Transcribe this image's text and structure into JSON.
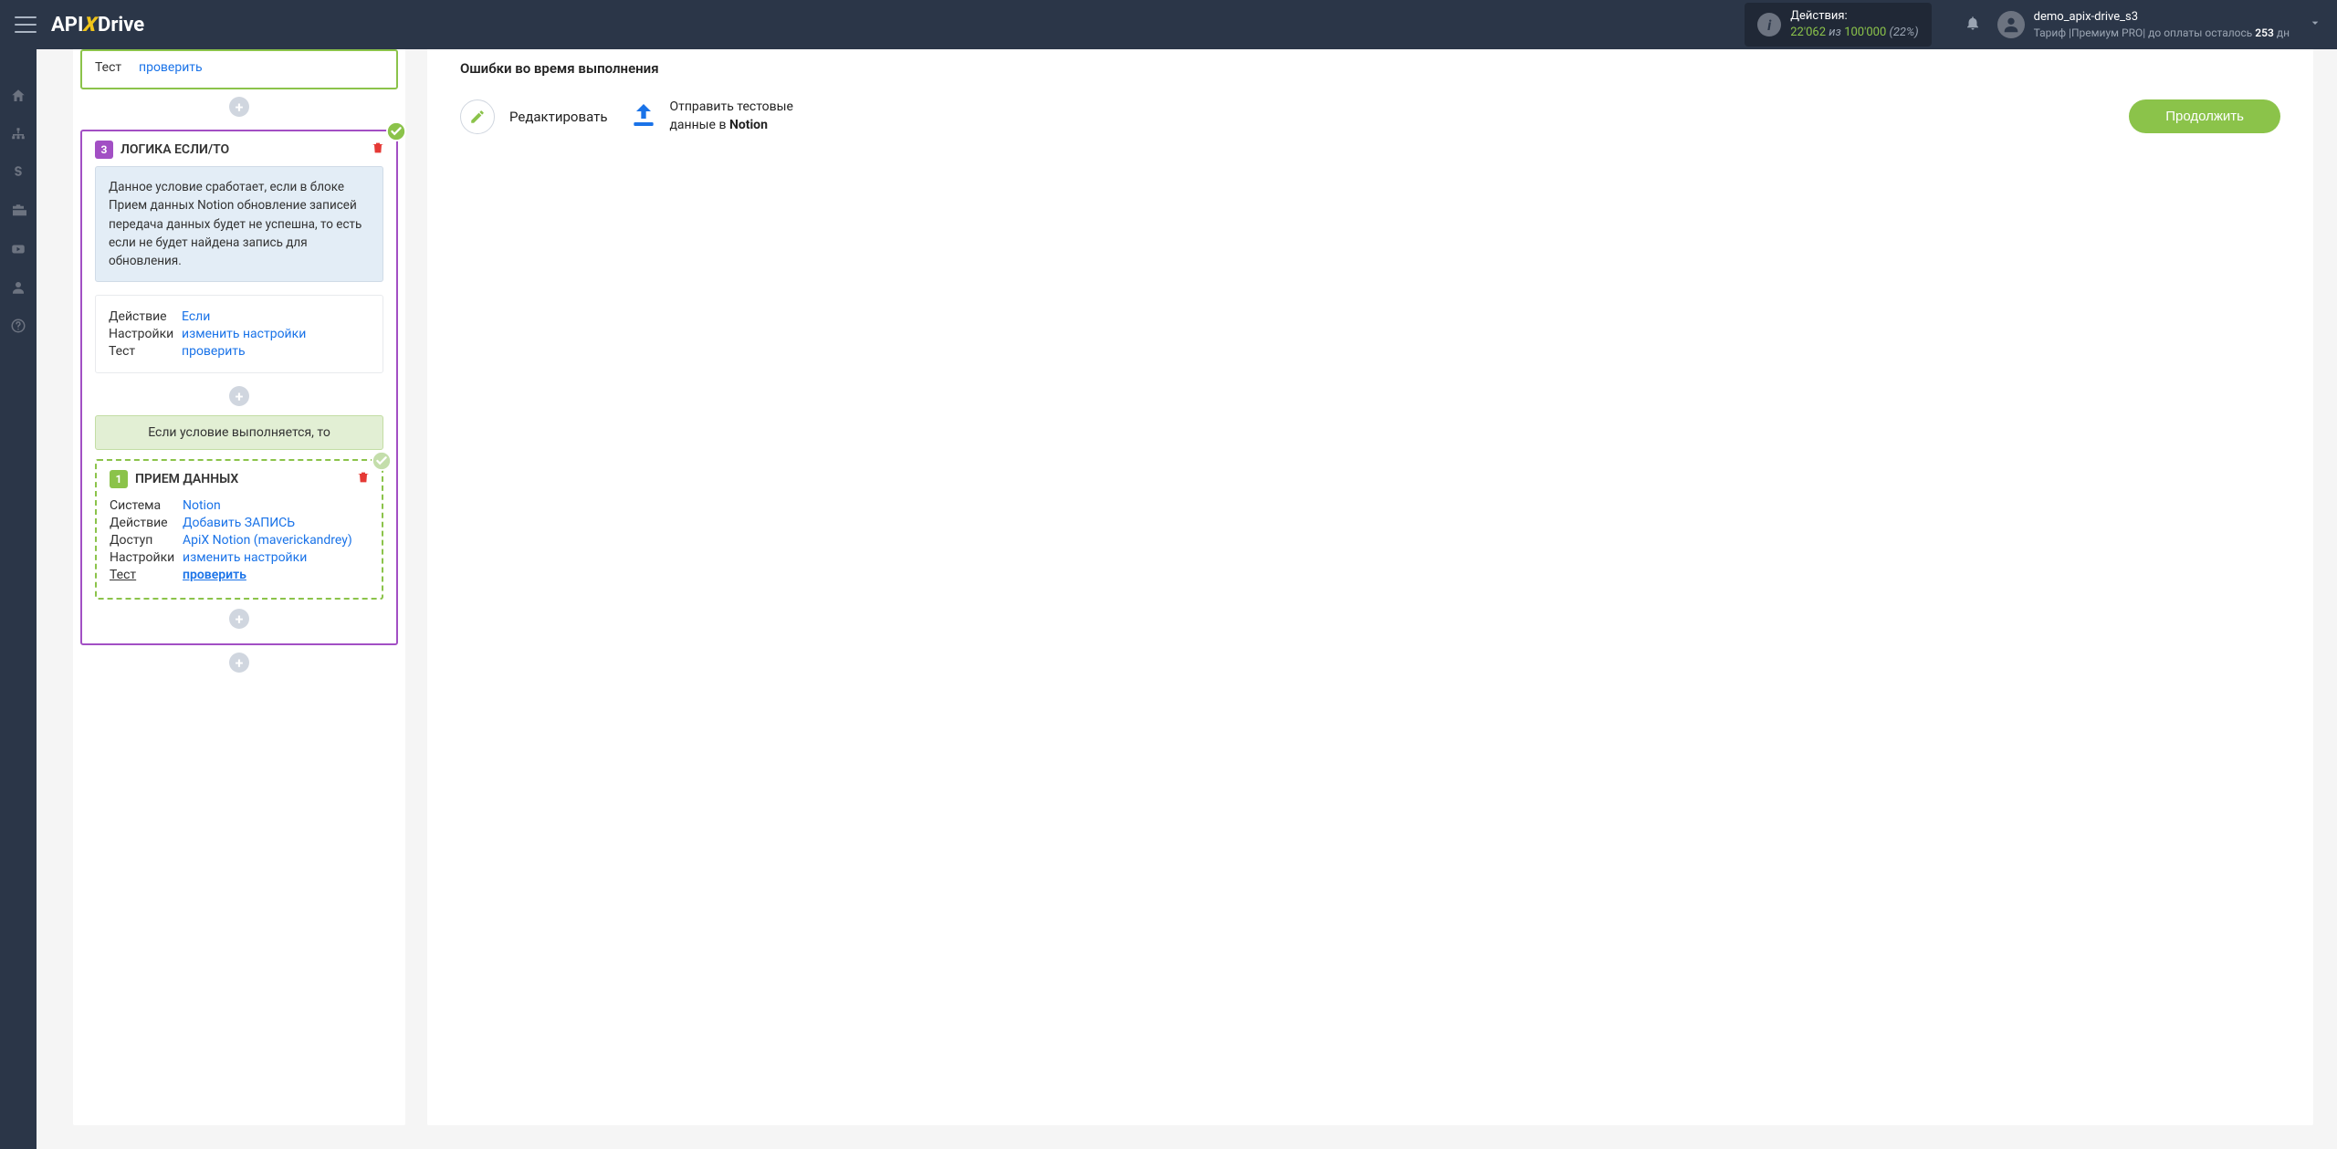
{
  "header": {
    "logo_a": "API",
    "logo_x": "X",
    "logo_b": "Drive",
    "actions_label": "Действия:",
    "actions_current": "22'062",
    "actions_of": "из",
    "actions_max": "100'000",
    "actions_pct": "(22%)",
    "username": "demo_apix-drive_s3",
    "tariff_prefix": "Тариф |Премиум PRO| до оплаты осталось ",
    "tariff_days": "253",
    "tariff_suffix": " дн"
  },
  "block2": {
    "test_label": "Тест",
    "test_link": "проверить"
  },
  "block3": {
    "num": "3",
    "title": "ЛОГИКА ЕСЛИ/ТО",
    "info": "Данное условие сработает, если в блоке Прием данных Notion обновление записей передача данных будет не успешна, то есть если не будет найдена запись для обновления.",
    "action_k": "Действие",
    "action_v": "Если",
    "settings_k": "Настройки",
    "settings_v": "изменить настройки",
    "test_k": "Тест",
    "test_v": "проверить",
    "cond_text": "Если условие выполняется, то"
  },
  "block1": {
    "num": "1",
    "title": "ПРИЕМ ДАННЫХ",
    "system_k": "Система",
    "system_v": "Notion",
    "action_k": "Действие",
    "action_v": "Добавить ЗАПИСЬ",
    "access_k": "Доступ",
    "access_v": "ApiX Notion (maverickandrey)",
    "settings_k": "Настройки",
    "settings_v": "изменить настройки",
    "test_k": "Тест",
    "test_v": "проверить"
  },
  "right": {
    "errors_title": "Ошибки во время выполнения",
    "edit_label": "Редактировать",
    "send_line1": "Отправить тестовые",
    "send_prefix": "данные в ",
    "send_notion": "Notion",
    "continue": "Продолжить"
  }
}
